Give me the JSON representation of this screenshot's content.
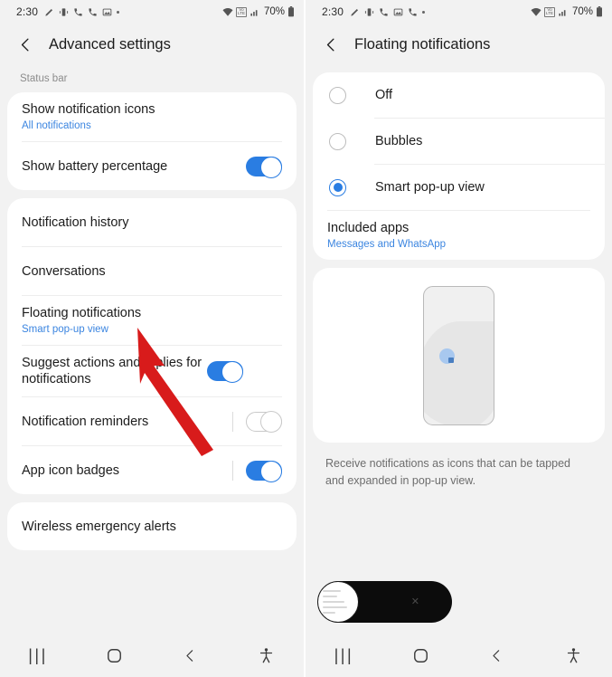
{
  "accent": "#2a7de2",
  "link_color": "#3b85e0",
  "left_screen": {
    "status_bar": {
      "time": "2:30",
      "left_icons": [
        "pencil-icon",
        "vibrate-icon",
        "call-icon",
        "call-forward-icon",
        "image-icon",
        "dot-icon"
      ],
      "wifi": "wifi-icon",
      "network": "VoLTE",
      "signal": "signal-bars-icon",
      "battery_percent": "70%",
      "battery": "battery-icon"
    },
    "title": "Advanced settings",
    "back_icon": "chevron-left-icon",
    "section_label": "Status bar",
    "card_status_bar": [
      {
        "title": "Show notification icons",
        "sub": "All notifications",
        "control": "none"
      },
      {
        "title": "Show battery percentage",
        "sub": "",
        "control": "toggle-on",
        "separator": false
      }
    ],
    "card_notifications": [
      {
        "title": "Notification history",
        "sub": "",
        "control": "none"
      },
      {
        "title": "Conversations",
        "sub": "",
        "control": "none"
      },
      {
        "title": "Floating notifications",
        "sub": "Smart pop-up view",
        "control": "none"
      },
      {
        "title": "Suggest actions and replies for notifications",
        "sub": "",
        "control": "toggle-on",
        "separator": false
      },
      {
        "title": "Notification reminders",
        "sub": "",
        "control": "toggle-off",
        "separator": true
      },
      {
        "title": "App icon badges",
        "sub": "",
        "control": "toggle-on",
        "separator": true
      }
    ],
    "card_alerts": [
      {
        "title": "Wireless emergency alerts",
        "sub": "",
        "control": "none"
      }
    ],
    "nav": {
      "recents": "|||",
      "home": "home-circle-icon",
      "back": "chevron-left-icon",
      "accessibility": "accessibility-icon"
    }
  },
  "right_screen": {
    "status_bar": {
      "time": "2:30",
      "left_icons": [
        "pencil-icon",
        "vibrate-icon",
        "call-icon",
        "image-icon",
        "call-forward-icon",
        "dot-icon"
      ],
      "network": "VoLTE",
      "battery_percent": "70%"
    },
    "title": "Floating notifications",
    "back_icon": "chevron-left-icon",
    "radio_options": [
      {
        "label": "Off",
        "selected": false
      },
      {
        "label": "Bubbles",
        "selected": false
      },
      {
        "label": "Smart pop-up view",
        "selected": true
      }
    ],
    "included_apps": {
      "title": "Included apps",
      "sub": "Messages and WhatsApp"
    },
    "illustration": "phone-with-bubble-illustration",
    "description": "Receive notifications as icons that can be tapped and expanded in pop-up view.",
    "bubble_overlay": {
      "close_label": "✕",
      "thumb": "app-preview-thumbnail"
    },
    "nav": {
      "recents": "|||",
      "home": "home-circle-icon",
      "back": "chevron-left-icon",
      "accessibility": "accessibility-icon"
    }
  },
  "annotation": {
    "arrow": "red-pointer-arrow"
  }
}
